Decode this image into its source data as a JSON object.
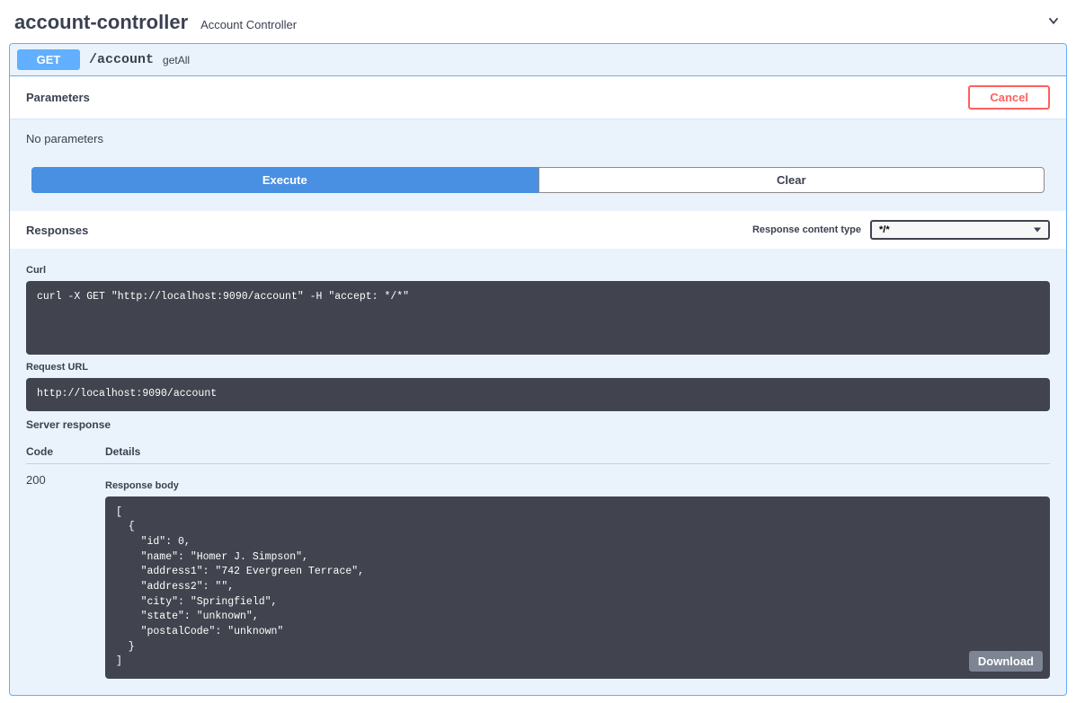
{
  "tag": {
    "name": "account-controller",
    "description": "Account Controller"
  },
  "operation": {
    "method": "GET",
    "path": "/account",
    "summary": "getAll"
  },
  "parameters": {
    "heading": "Parameters",
    "cancel_label": "Cancel",
    "none_text": "No parameters"
  },
  "actions": {
    "execute_label": "Execute",
    "clear_label": "Clear"
  },
  "responses": {
    "heading": "Responses",
    "content_type_label": "Response content type",
    "content_type_value": "*/*"
  },
  "curl": {
    "heading": "Curl",
    "command": "curl -X GET \"http://localhost:9090/account\" -H \"accept: */*\""
  },
  "request_url": {
    "heading": "Request URL",
    "value": "http://localhost:9090/account"
  },
  "server_response": {
    "heading": "Server response",
    "code_header": "Code",
    "details_header": "Details",
    "code": "200",
    "body_heading": "Response body",
    "download_label": "Download",
    "body": "[\n  {\n    \"id\": 0,\n    \"name\": \"Homer J. Simpson\",\n    \"address1\": \"742 Evergreen Terrace\",\n    \"address2\": \"\",\n    \"city\": \"Springfield\",\n    \"state\": \"unknown\",\n    \"postalCode\": \"unknown\"\n  }\n]"
  }
}
